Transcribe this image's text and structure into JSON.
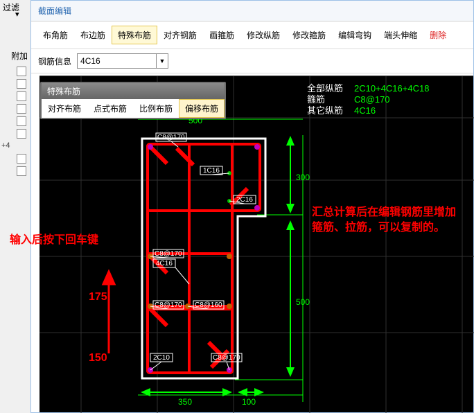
{
  "sidebar": {
    "filter_label": "过滤",
    "filter_dropdown": "▾",
    "attach_label": "附加",
    "plus_q": "+4"
  },
  "panel_title": "截面编辑",
  "toolbar": [
    "布角筋",
    "布边筋",
    "特殊布筋",
    "对齐钢筋",
    "画箍筋",
    "修改纵筋",
    "修改箍筋",
    "编辑弯钩",
    "端头伸缩",
    "删除"
  ],
  "toolbar_active_index": 2,
  "field_label": "钢筋信息",
  "field_value": "4C16",
  "subtool": {
    "title": "特殊布筋",
    "buttons": [
      "对齐布筋",
      "点式布筋",
      "比例布筋",
      "偏移布筋"
    ],
    "active_index": 3
  },
  "legend": {
    "rows": [
      {
        "label": "全部纵筋",
        "value": "2C10+4C16+4C18"
      },
      {
        "label": "箍筋",
        "value": "C8@170"
      },
      {
        "label": "其它纵筋",
        "value": "4C16"
      }
    ]
  },
  "dims": {
    "top_overall": "500",
    "right_upper": "300",
    "right_lower": "500",
    "bottom_left": "350",
    "bottom_right": "100"
  },
  "rebar_tags": [
    "C8@170",
    "1C16",
    "2C16",
    "C8@170",
    "4C16",
    "C8@170",
    "C8@160",
    "2C10",
    "C8@170"
  ],
  "annotations": {
    "left_line": "输入后按下回车键",
    "right_block": "汇总计算后在编辑钢筋里增加箍筋、拉筋，可以复制的。",
    "num_a": "175",
    "num_b": "150"
  }
}
